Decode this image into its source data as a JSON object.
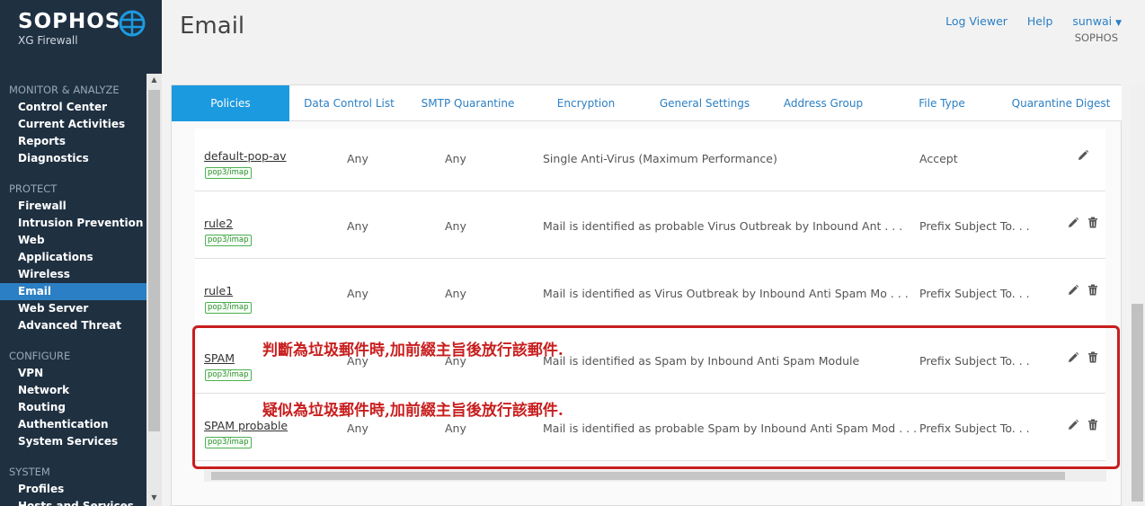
{
  "brand": {
    "name": "SOPHOS",
    "product": "XG Firewall"
  },
  "sidebar": {
    "sections": [
      {
        "title": "MONITOR & ANALYZE",
        "items": [
          "Control Center",
          "Current Activities",
          "Reports",
          "Diagnostics"
        ]
      },
      {
        "title": "PROTECT",
        "items": [
          "Firewall",
          "Intrusion Prevention",
          "Web",
          "Applications",
          "Wireless",
          "Email",
          "Web Server",
          "Advanced Threat"
        ]
      },
      {
        "title": "CONFIGURE",
        "items": [
          "VPN",
          "Network",
          "Routing",
          "Authentication",
          "System Services"
        ]
      },
      {
        "title": "SYSTEM",
        "items": [
          "Profiles",
          "Hosts and Services"
        ]
      }
    ],
    "active": "Email"
  },
  "header": {
    "title": "Email",
    "log_viewer": "Log Viewer",
    "help": "Help",
    "user": "sunwai",
    "org": "SOPHOS"
  },
  "tabs": [
    "Policies",
    "Data Control List",
    "SMTP Quarantine",
    "Encryption",
    "General Settings",
    "Address Group",
    "File Type",
    "Quarantine Digest"
  ],
  "active_tab": "Policies",
  "rows": [
    {
      "name": "default-pop-av",
      "badge": "pop3/imap",
      "from": "Any",
      "to": "Any",
      "description": "Single Anti-Virus (Maximum Performance)",
      "action": "Accept",
      "deletable": false
    },
    {
      "name": "rule2",
      "badge": "pop3/imap",
      "from": "Any",
      "to": "Any",
      "description": "Mail is identified as probable Virus Outbreak by Inbound Ant . . .",
      "action": "Prefix Subject To. . .",
      "deletable": true
    },
    {
      "name": "rule1",
      "badge": "pop3/imap",
      "from": "Any",
      "to": "Any",
      "description": "Mail is identified as Virus Outbreak by Inbound Anti Spam Mo . . .",
      "action": "Prefix Subject To. . .",
      "deletable": true
    },
    {
      "name": "SPAM",
      "badge": "pop3/imap",
      "from": "Any",
      "to": "Any",
      "description": "Mail is identified as Spam by Inbound Anti Spam Module",
      "action": "Prefix Subject To. . .",
      "deletable": true
    },
    {
      "name": "SPAM probable",
      "badge": "pop3/imap",
      "from": "Any",
      "to": "Any",
      "description": "Mail is identified as probable Spam by Inbound Anti Spam Mod . . .",
      "action": "Prefix Subject To. . .",
      "deletable": true
    }
  ],
  "annotations": [
    "判斷為垃圾郵件時,加前綴主旨後放行該郵件.",
    "疑似為垃圾郵件時,加前綴主旨後放行該郵件."
  ],
  "colors": {
    "sidebar_bg": "#1f3041",
    "accent": "#1c9ae0",
    "annotation": "#c81e1e"
  }
}
